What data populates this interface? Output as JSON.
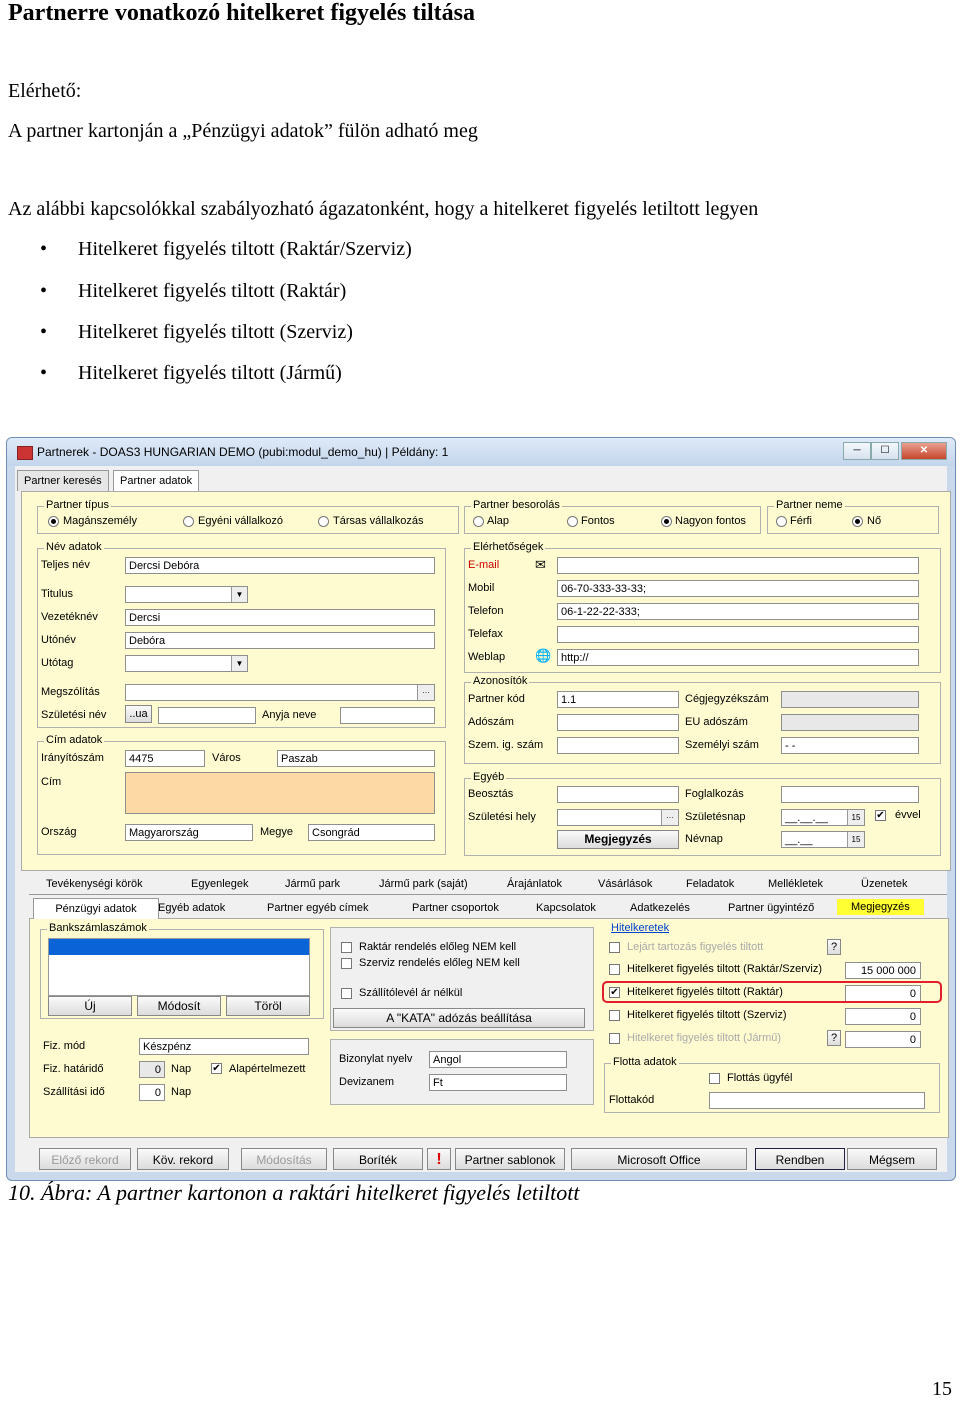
{
  "doc": {
    "title": "Partnerre vonatkozó hitelkeret figyelés tiltása",
    "available_label": "Elérhető:",
    "available_text": "A partner kartonján a „Pénzügyi adatok” fülön adható meg",
    "intro": "Az alábbi kapcsolókkal szabályozható ágazatonként, hogy a hitelkeret figyelés letiltott legyen",
    "bullets": [
      "Hitelkeret figyelés tiltott (Raktár/Szerviz)",
      "Hitelkeret figyelés tiltott (Raktár)",
      "Hitelkeret figyelés tiltott (Szerviz)",
      "Hitelkeret figyelés tiltott (Jármű)"
    ],
    "caption": "10. Ábra: A partner kartonon a raktári hitelkeret figyelés letiltott",
    "page_number": "15"
  },
  "window": {
    "title": "Partnerek - DOAS3 HUNGARIAN DEMO (pubi:modul_demo_hu) | Példány: 1",
    "btn_min": "─",
    "btn_max": "☐",
    "btn_close": "✕",
    "tabs": [
      "Partner keresés",
      "Partner adatok"
    ],
    "partner_tipus": {
      "label": "Partner típus",
      "options": [
        "Magánszemély",
        "Egyéni vállalkozó",
        "Társas vállalkozás"
      ]
    },
    "besorolas": {
      "label": "Partner besorolás",
      "options": [
        "Alap",
        "Fontos",
        "Nagyon fontos"
      ]
    },
    "neme": {
      "label": "Partner neme",
      "options": [
        "Férfi",
        "Nő"
      ]
    },
    "nev": {
      "label": "Név adatok",
      "teljes_nev_label": "Teljes név",
      "teljes_nev": "Dercsi Debóra",
      "titulus_label": "Titulus",
      "vezeteknev_label": "Vezetéknév",
      "vezeteknev": "Dercsi",
      "utonev_label": "Utónév",
      "utonev": "Debóra",
      "utotag_label": "Utótag",
      "megszolitas_label": "Megszólítás",
      "szuletesi_nev_label": "Születési név",
      "ua": "..ua",
      "anyja_neve_label": "Anyja neve"
    },
    "cim": {
      "label": "Cím adatok",
      "irsz_label": "Irányítószám",
      "irsz": "4475",
      "varos_label": "Város",
      "varos": "Paszab",
      "cim_label": "Cím",
      "orszag_label": "Ország",
      "orszag": "Magyarország",
      "megye_label": "Megye",
      "megye": "Csongrád"
    },
    "elerhetosegek": {
      "label": "Elérhetőségek",
      "email_label": "E-mail",
      "mobil_label": "Mobil",
      "mobil": "06-70-333-33-33;",
      "telefon_label": "Telefon",
      "telefon": "06-1-22-22-333;",
      "telefax_label": "Telefax",
      "weblap_label": "Weblap",
      "weblap": "http://"
    },
    "azonositok": {
      "label": "Azonosítók",
      "partner_kod_label": "Partner kód",
      "partner_kod": "1.1",
      "cegjegyzekszam_label": "Cégjegyzékszám",
      "adoszam_label": "Adószám",
      "eu_adoszam_label": "EU adószám",
      "szem_ig_label": "Szem. ig. szám",
      "szemelyi_szam_label": "Személyi szám",
      "szemelyi_szam": "-    -"
    },
    "egyeb": {
      "label": "Egyéb",
      "beosztas_label": "Beosztás",
      "foglalkozas_label": "Foglalkozás",
      "szuletesi_hely_label": "Születési hely",
      "szuletesnap_label": "Születésnap",
      "szuletesnap": "__.__.__",
      "evvel_label": "évvel",
      "megjegyzes_btn": "Megjegyzés",
      "nevnap_label": "Névnap",
      "nevnap": "__.__"
    },
    "tabs_row1": [
      "Tevékenységi körök",
      "Egyenlegek",
      "Jármű park",
      "Jármű park (saját)",
      "Árajánlatok",
      "Vásárlások",
      "Feladatok",
      "Mellékletek",
      "Üzenetek"
    ],
    "tabs_row2": [
      "Pénzügyi adatok",
      "Egyéb adatok",
      "Partner egyéb címek",
      "Partner csoportok",
      "Kapcsolatok",
      "Adatkezelés",
      "Partner ügyintéző",
      "Megjegyzés"
    ],
    "bankszamla": {
      "label": "Bankszámlaszámok",
      "uj": "Új",
      "modosit": "Módosít",
      "torol": "Töröl"
    },
    "rendeles": {
      "raktar": "Raktár rendelés előleg NEM kell",
      "szerviz": "Szerviz rendelés előleg NEM kell",
      "szallitolevel": "Szállítólevél ár nélkül",
      "kata_btn": "A \"KATA\" adózás beállítása"
    },
    "hitelkeretek": {
      "label": "Hitelkeretek",
      "lejart": "Lejárt tartozás figyelés tiltott",
      "raktar_szerviz": "Hitelkeret figyelés tiltott (Raktár/Szerviz)",
      "raktar_szerviz_value": "15 000 000",
      "raktar": "Hitelkeret figyelés tiltott (Raktár)",
      "raktar_value": "0",
      "szerviz": "Hitelkeret figyelés tiltott (Szerviz)",
      "szerviz_value": "0",
      "jarmu": "Hitelkeret figyelés tiltott (Jármű)",
      "jarmu_value": "0",
      "help": "?"
    },
    "fizetes": {
      "mod_label": "Fiz. mód",
      "mod": "Készpénz",
      "hatarido_label": "Fiz. határidő",
      "hatarido": "0",
      "nap": "Nap",
      "alapertelmezett": "Alapértelmezett",
      "szallitasi_ido_label": "Szállítási idő",
      "szallitasi_ido": "0"
    },
    "bizonylat": {
      "nyelv_label": "Bizonylat nyelv",
      "nyelv": "Angol",
      "devizanem_label": "Devizanem",
      "devizanem": "Ft"
    },
    "flotta": {
      "label": "Flotta adatok",
      "ugyfel": "Flottás ügyfél",
      "flottakod_label": "Flottakód"
    },
    "bottom_buttons": [
      "Előző rekord",
      "Köv. rekord",
      "Módosítás",
      "Boríték",
      "!",
      "Partner sablonok",
      "Microsoft Office",
      "Rendben",
      "Mégsem"
    ]
  }
}
